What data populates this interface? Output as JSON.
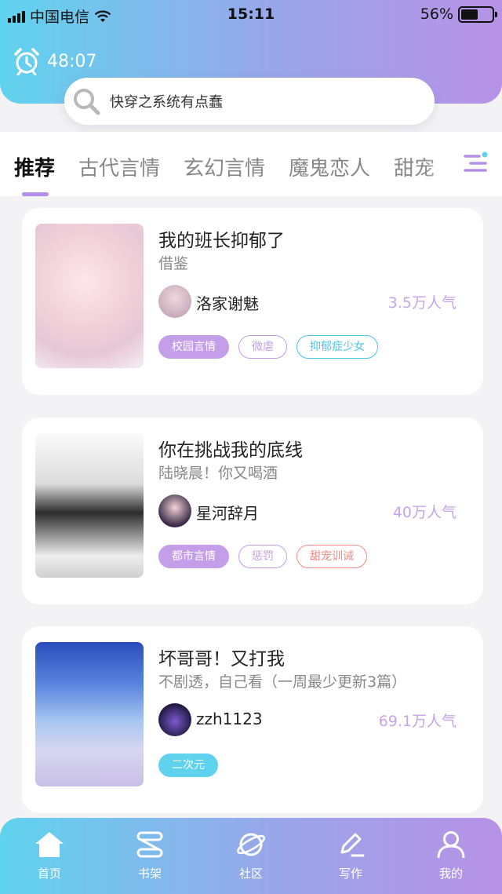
{
  "status_bar": {
    "carrier": "中国电信",
    "time": "15:11",
    "battery_percent": "56%",
    "battery_level": 0.56
  },
  "timer": {
    "value": "48:07",
    "icon": "alarm-clock-icon"
  },
  "search": {
    "placeholder": "快穿之系统有点蠢",
    "icon": "search-icon"
  },
  "category_tabs": [
    {
      "label": "推荐",
      "active": true
    },
    {
      "label": "古代言情",
      "active": false
    },
    {
      "label": "玄幻言情",
      "active": false
    },
    {
      "label": "魔鬼恋人",
      "active": false
    },
    {
      "label": "甜宠",
      "active": false
    }
  ],
  "menu_icon": "filter-menu-icon",
  "books": [
    {
      "title": "我的班长抑郁了",
      "subtitle": "借鉴",
      "author": "洛家谢魅",
      "popularity": "3.5万人气",
      "tags": [
        {
          "label": "校园言情",
          "style": "filled",
          "color": "#c49ee9"
        },
        {
          "label": "微虐",
          "style": "outline",
          "color": "#c49ee9"
        },
        {
          "label": "抑郁症少女",
          "style": "outline",
          "color": "#4cc4e8"
        }
      ]
    },
    {
      "title": "你在挑战我的底线",
      "subtitle": "陆晓晨！你又喝酒",
      "author": "星河辞月",
      "popularity": "40万人气",
      "tags": [
        {
          "label": "都市言情",
          "style": "filled",
          "color": "#c49ee9"
        },
        {
          "label": "惩罚",
          "style": "outline",
          "color": "#c49ee9"
        },
        {
          "label": "甜宠训诫",
          "style": "outline",
          "color": "#ef8b86"
        }
      ]
    },
    {
      "title": "坏哥哥！又打我",
      "subtitle": "不剧透，自己看（一周最少更新3篇）",
      "author": "zzh1123",
      "popularity": "69.1万人气",
      "tags": [
        {
          "label": "二次元",
          "style": "filled",
          "color": "#5fd3ee"
        }
      ]
    }
  ],
  "bottom_nav": [
    {
      "label": "首页",
      "icon": "home-icon",
      "active": true
    },
    {
      "label": "书架",
      "icon": "bookshelf-icon",
      "active": false
    },
    {
      "label": "社区",
      "icon": "planet-icon",
      "active": false
    },
    {
      "label": "写作",
      "icon": "pen-write-icon",
      "active": false
    },
    {
      "label": "我的",
      "icon": "user-profile-icon",
      "active": false
    }
  ],
  "colors": {
    "accent_purple": "#b58ee8",
    "accent_cyan": "#5fd3ee",
    "popularity_text": "#c6a4ea"
  }
}
